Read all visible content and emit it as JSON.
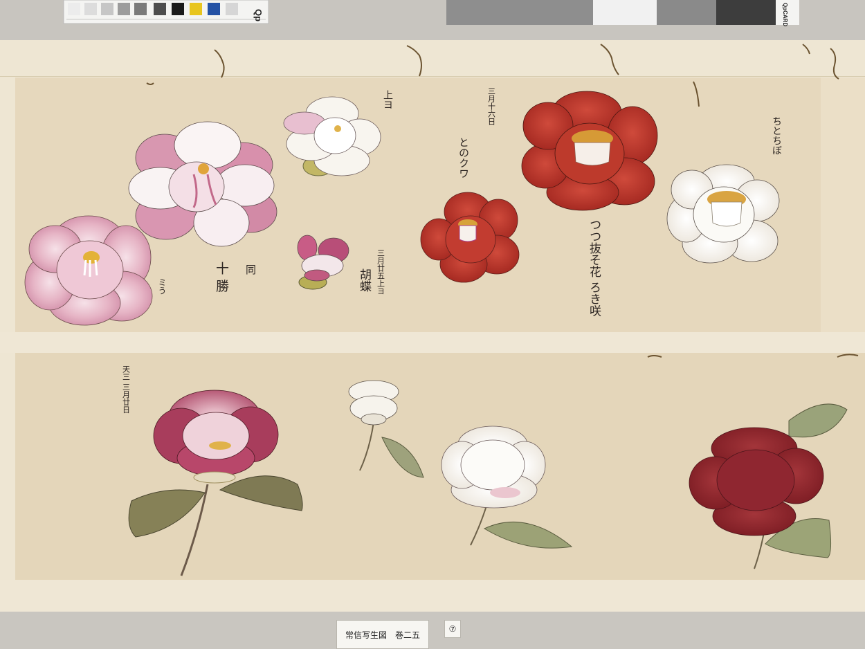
{
  "catalog": {
    "title_card": "常信写生図　巻二五",
    "page_number": "⑦"
  },
  "color_card": {
    "left_brand": "Qp",
    "right_brand": "QpCARD"
  },
  "scroll": {
    "paper_color": "#e8dcc4",
    "mount_color": "#efe7d4",
    "annotations": [
      {
        "id": "upper-1",
        "text": "上ヨ"
      },
      {
        "id": "date-mar16",
        "text": "三月十六日"
      },
      {
        "id": "name-tonokuwa",
        "text": "とのクワ"
      },
      {
        "id": "name-right-top",
        "text": "ちとちぼ"
      },
      {
        "id": "name-juban",
        "text": "十 勝"
      },
      {
        "id": "same",
        "text": "同"
      },
      {
        "id": "small-left",
        "text": "ミう"
      },
      {
        "id": "date-mar-upper",
        "text": "三月廿五上ヨ"
      },
      {
        "id": "name-kocho",
        "text": "胡蝶"
      },
      {
        "id": "poem",
        "text": "つつ抜そ花 ろき咲"
      },
      {
        "id": "lower-date",
        "text": "天三 三月廿日"
      }
    ]
  },
  "colors": {
    "pink": "#d9a2b6",
    "white": "#f5f1ea",
    "red": "#b8322a",
    "crimson": "#962a30",
    "leaf": "#8f9673"
  }
}
